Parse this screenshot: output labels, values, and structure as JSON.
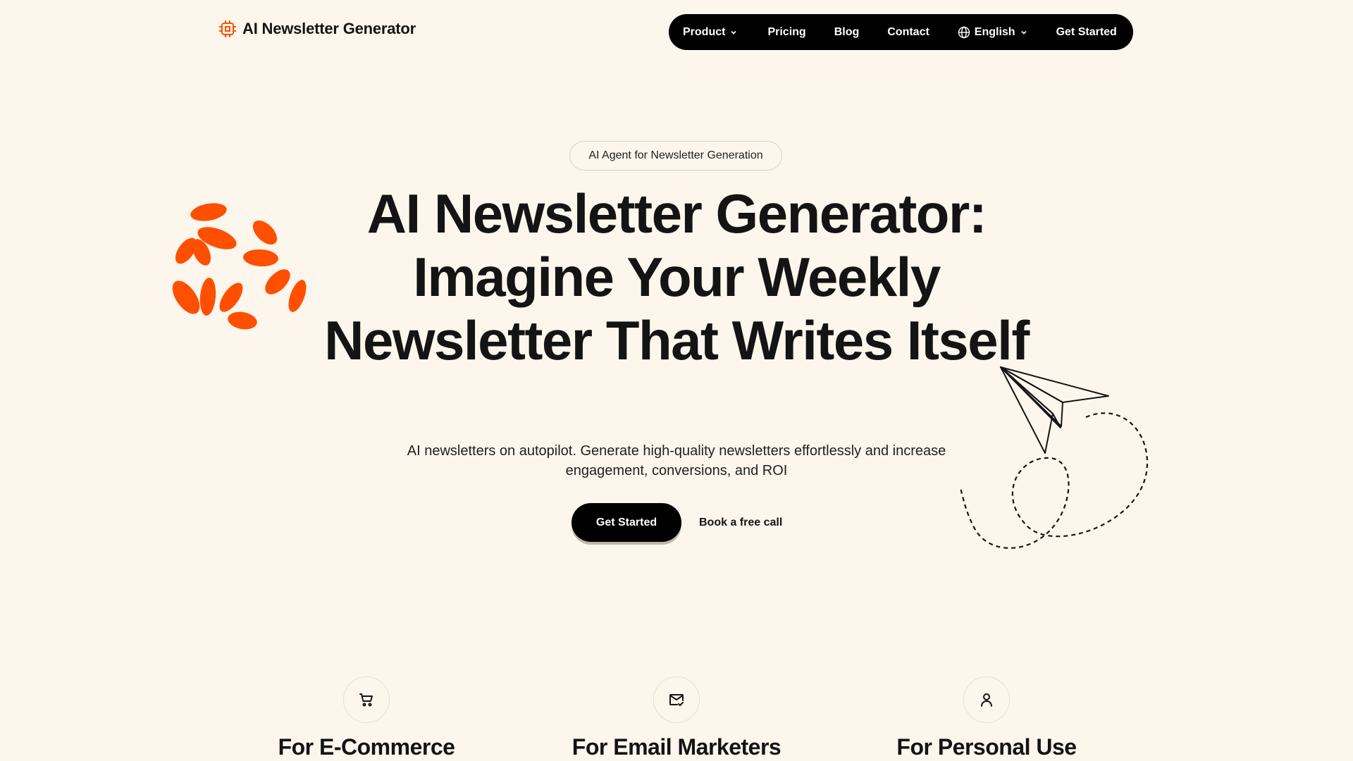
{
  "header": {
    "brand_name": "AI Newsletter Generator",
    "brand_icon": "chip-icon",
    "accent_color": "#ff4f00",
    "nav": {
      "product": "Product",
      "pricing": "Pricing",
      "blog": "Blog",
      "contact": "Contact",
      "language": "English",
      "get_started": "Get Started"
    }
  },
  "hero": {
    "badge": "AI Agent for Newsletter Generation",
    "title": "AI Newsletter Generator: Imagine Your Weekly Newsletter That Writes Itself",
    "subtitle": "AI newsletters on autopilot. Generate high-quality newsletters effortlessly and increase engagement, conversions, and ROI",
    "primary_cta": "Get Started",
    "secondary_cta": "Book a free call"
  },
  "features": [
    {
      "icon": "shopping-cart-icon",
      "title": "For E-Commerce"
    },
    {
      "icon": "mail-check-icon",
      "title": "For Email Marketers"
    },
    {
      "icon": "user-icon",
      "title": "For Personal Use"
    }
  ],
  "colors": {
    "background": "#fdf6ec",
    "accent": "#ff4f00",
    "nav_bg": "#000000",
    "text": "#141414"
  }
}
